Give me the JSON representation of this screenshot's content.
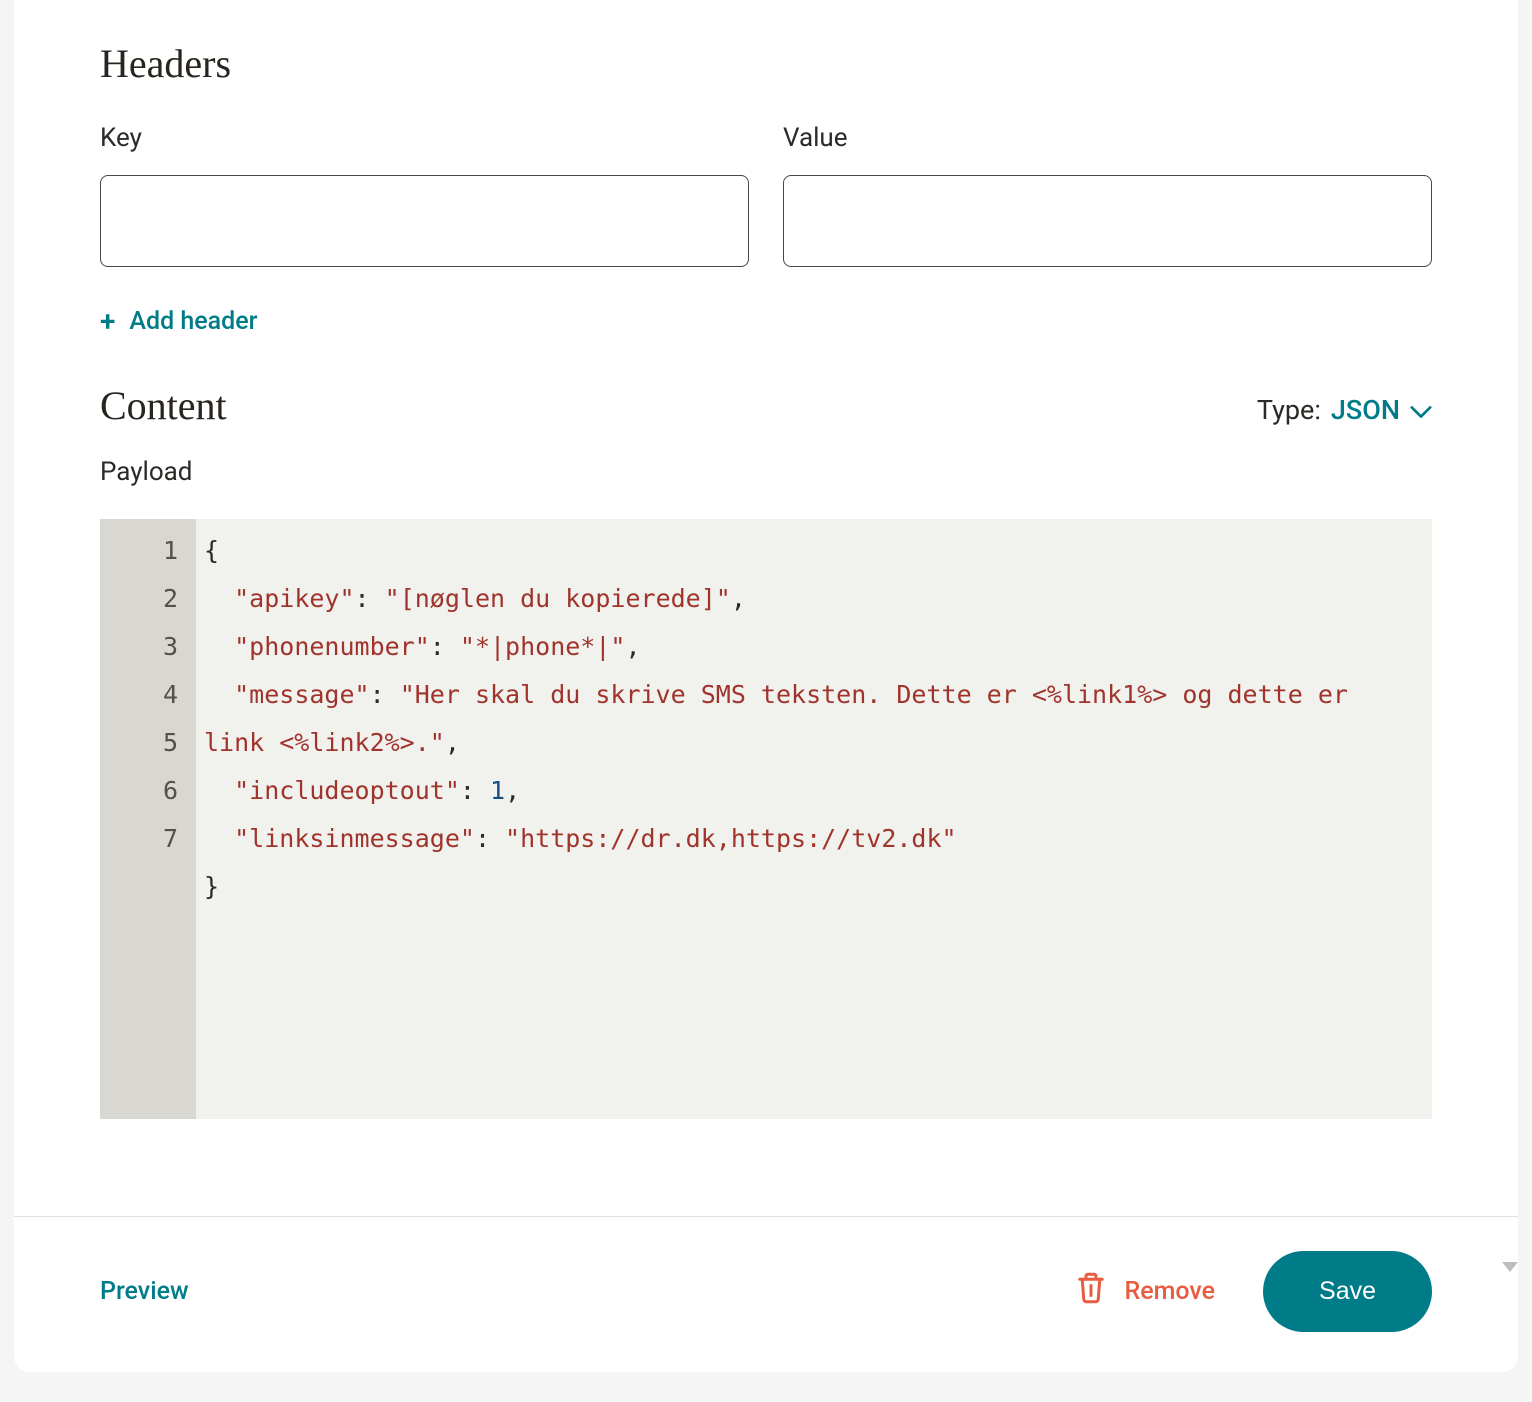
{
  "headers": {
    "title": "Headers",
    "key_label": "Key",
    "value_label": "Value",
    "key_value": "",
    "value_value": "",
    "add_label": "Add header"
  },
  "content": {
    "title": "Content",
    "type_label": "Type:",
    "type_value": "JSON",
    "payload_label": "Payload",
    "code": {
      "line_numbers": [
        "1",
        "2",
        "3",
        "4",
        "5",
        "6",
        "7"
      ],
      "lines": [
        {
          "tokens": [
            {
              "t": "{",
              "c": "punc"
            }
          ]
        },
        {
          "tokens": [
            {
              "t": "  ",
              "c": "punc"
            },
            {
              "t": "\"apikey\"",
              "c": "key"
            },
            {
              "t": ": ",
              "c": "punc"
            },
            {
              "t": "\"[nøglen du kopierede]\"",
              "c": "str"
            },
            {
              "t": ",",
              "c": "punc"
            }
          ]
        },
        {
          "tokens": [
            {
              "t": "  ",
              "c": "punc"
            },
            {
              "t": "\"phonenumber\"",
              "c": "key"
            },
            {
              "t": ": ",
              "c": "punc"
            },
            {
              "t": "\"*|phone*|\"",
              "c": "str"
            },
            {
              "t": ",",
              "c": "punc"
            }
          ]
        },
        {
          "tokens": [
            {
              "t": "  ",
              "c": "punc"
            },
            {
              "t": "\"message\"",
              "c": "key"
            },
            {
              "t": ": ",
              "c": "punc"
            },
            {
              "t": "\"Her skal du skrive SMS teksten. Dette er <%link1%> og dette er link <%link2%>.\"",
              "c": "str"
            },
            {
              "t": ",",
              "c": "punc"
            }
          ]
        },
        {
          "tokens": [
            {
              "t": "  ",
              "c": "punc"
            },
            {
              "t": "\"includeoptout\"",
              "c": "key"
            },
            {
              "t": ": ",
              "c": "punc"
            },
            {
              "t": "1",
              "c": "num"
            },
            {
              "t": ",",
              "c": "punc"
            }
          ]
        },
        {
          "tokens": [
            {
              "t": "  ",
              "c": "punc"
            },
            {
              "t": "\"linksinmessage\"",
              "c": "key"
            },
            {
              "t": ": ",
              "c": "punc"
            },
            {
              "t": "\"https://dr.dk,https://tv2.dk\"",
              "c": "str"
            }
          ]
        },
        {
          "tokens": [
            {
              "t": "}",
              "c": "punc"
            }
          ]
        }
      ]
    }
  },
  "footer": {
    "preview_label": "Preview",
    "remove_label": "Remove",
    "save_label": "Save"
  }
}
